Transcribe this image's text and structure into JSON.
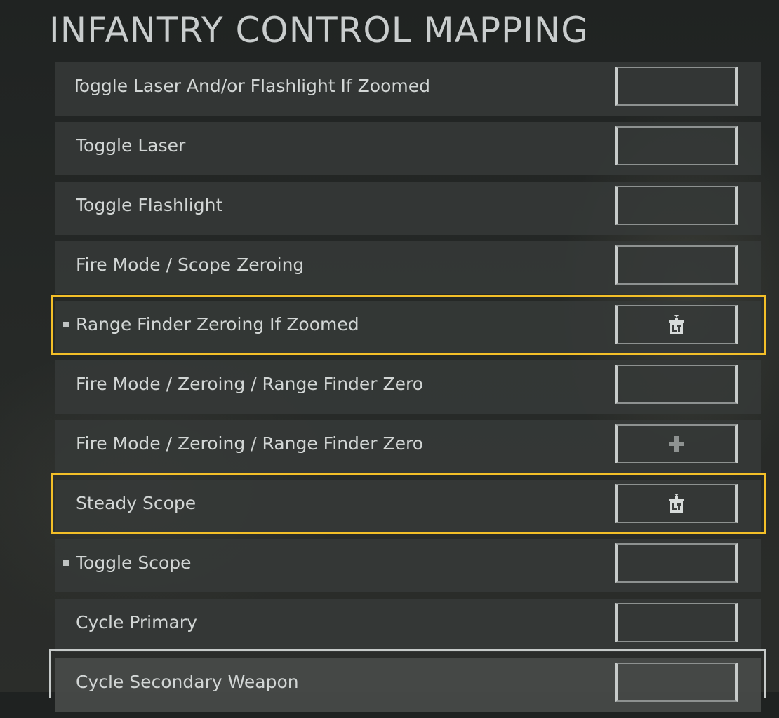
{
  "page": {
    "title": "INFANTRY CONTROL MAPPING"
  },
  "rows": [
    {
      "label": "Toggle Laser And/or Flashlight If Zoomed",
      "binding": ""
    },
    {
      "label": "Toggle Laser",
      "binding": ""
    },
    {
      "label": "Toggle Flashlight",
      "binding": ""
    },
    {
      "label": "Fire Mode / Scope Zeroing",
      "binding": ""
    },
    {
      "label": "Range Finder Zeroing If Zoomed",
      "binding": "lt-button-icon"
    },
    {
      "label": "Fire Mode / Zeroing / Range Finder Zero",
      "binding": ""
    },
    {
      "label": "Fire Mode / Zeroing / Range Finder Zero",
      "binding": "dpad-icon"
    },
    {
      "label": "Steady Scope",
      "binding": "lt-button-icon"
    },
    {
      "label": "Toggle Scope",
      "binding": ""
    },
    {
      "label": "Cycle Primary",
      "binding": ""
    },
    {
      "label": "Cycle Secondary Weapon",
      "binding": ""
    }
  ],
  "colors": {
    "highlight": "#f3bf28",
    "row": "#363938",
    "text": "#d2d6d5"
  }
}
